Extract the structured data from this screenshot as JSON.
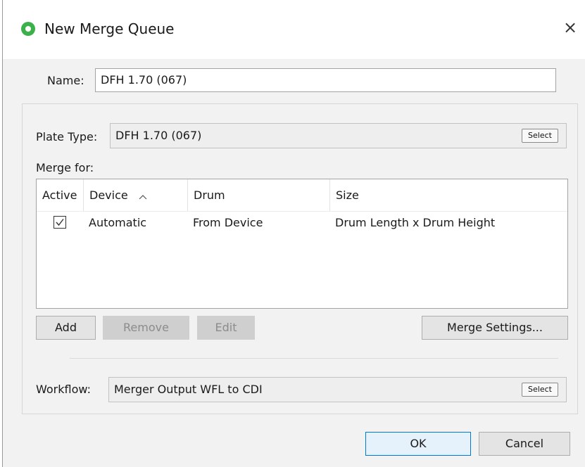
{
  "dialog": {
    "title": "New Merge Queue",
    "close_icon": "×"
  },
  "name": {
    "label": "Name:",
    "value": "DFH 1.70 (067)"
  },
  "plate_type": {
    "label": "Plate Type:",
    "value": "DFH 1.70 (067)",
    "select_label": "Select"
  },
  "merge_for": {
    "label": "Merge for:",
    "columns": [
      "Active",
      "Device",
      "Drum",
      "Size"
    ],
    "sort_indicator": "^",
    "rows": [
      {
        "active": true,
        "device": "Automatic",
        "drum": "From Device",
        "size": "Drum Length x Drum Height"
      }
    ]
  },
  "buttons": {
    "add": "Add",
    "remove": "Remove",
    "edit": "Edit",
    "merge_settings": "Merge Settings..."
  },
  "workflow": {
    "label": "Workflow:",
    "value": "Merger Output WFL to CDI",
    "select_label": "Select"
  },
  "footer": {
    "ok": "OK",
    "cancel": "Cancel"
  },
  "colors": {
    "app_icon": "#3cb04a",
    "primary_border": "#0078d7"
  }
}
